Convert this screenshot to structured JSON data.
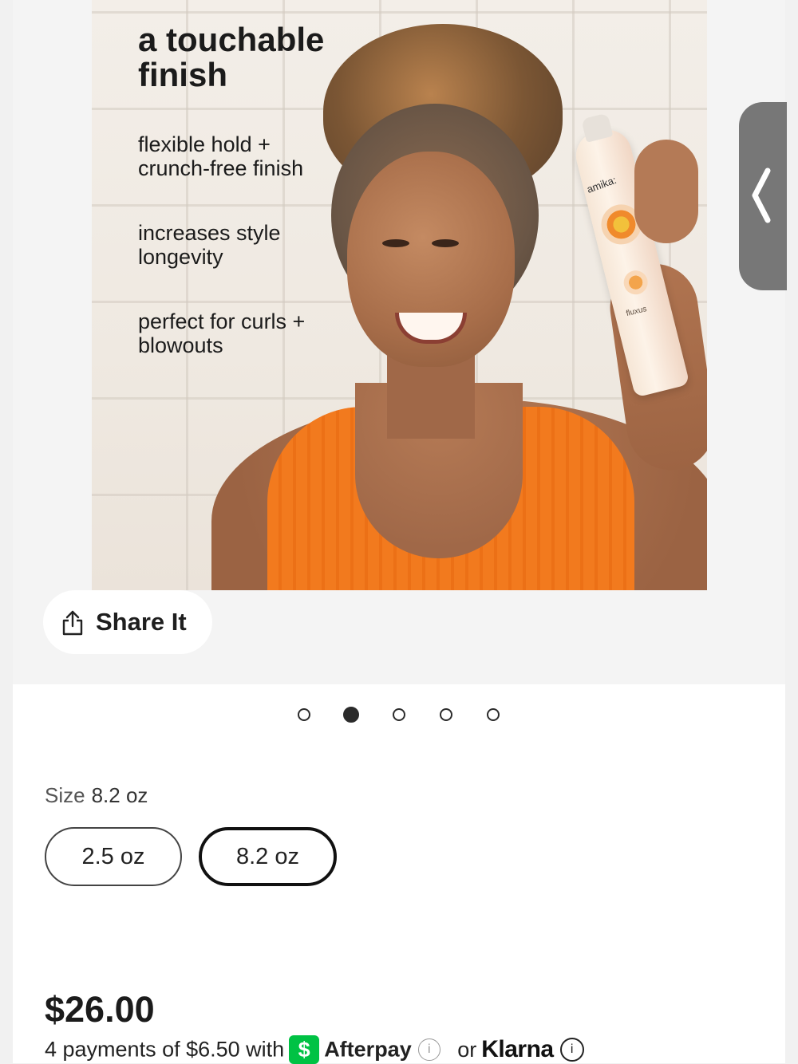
{
  "hero": {
    "headline": "a touchable finish",
    "features": [
      "flexible hold + crunch-free finish",
      "increases style longevity",
      "perfect for curls + blowouts"
    ],
    "can_brand": "amika:",
    "can_product": "fluxus"
  },
  "share": {
    "label": "Share It",
    "icon": "share-icon"
  },
  "side_tab": {
    "icon": "chevron-left-icon"
  },
  "carousel": {
    "count": 5,
    "active_index": 1
  },
  "size": {
    "label": "Size",
    "selected": "8.2 oz",
    "options": [
      "2.5 oz",
      "8.2 oz"
    ]
  },
  "price": {
    "amount": "$26.00",
    "installments_prefix": "4 payments of $6.50 with",
    "afterpay_badge": "$",
    "afterpay_name": "Afterpay",
    "or_text": "or",
    "klarna_name": "Klarna",
    "info_glyph": "i"
  },
  "colors": {
    "afterpay_green": "#00c244",
    "tank_orange": "#f27a1e",
    "side_tab_gray": "#777777"
  }
}
